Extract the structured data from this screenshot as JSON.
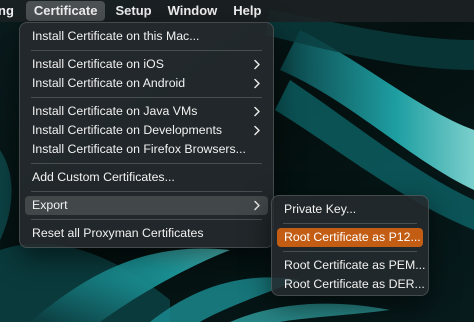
{
  "menubar": {
    "items": [
      {
        "label": "ng"
      },
      {
        "label": "Certificate"
      },
      {
        "label": "Setup"
      },
      {
        "label": "Window"
      },
      {
        "label": "Help"
      }
    ]
  },
  "certificate_menu": {
    "install_mac": "Install Certificate on this Mac...",
    "install_ios": "Install Certificate on iOS",
    "install_android": "Install Certificate on Android",
    "install_java": "Install Certificate on Java VMs",
    "install_developments": "Install Certificate on Developments",
    "install_firefox": "Install Certificate on Firefox Browsers...",
    "add_custom": "Add Custom Certificates...",
    "export": "Export",
    "reset": "Reset all Proxyman Certificates"
  },
  "export_submenu": {
    "private_key": "Private Key...",
    "root_p12": "Root Certificate as P12...",
    "root_pem": "Root Certificate as PEM...",
    "root_der": "Root Certificate as DER..."
  },
  "colors": {
    "highlight": "#c25d13",
    "menu_background": "#262b2e",
    "wallpaper_accent": "#2fc8c8"
  }
}
